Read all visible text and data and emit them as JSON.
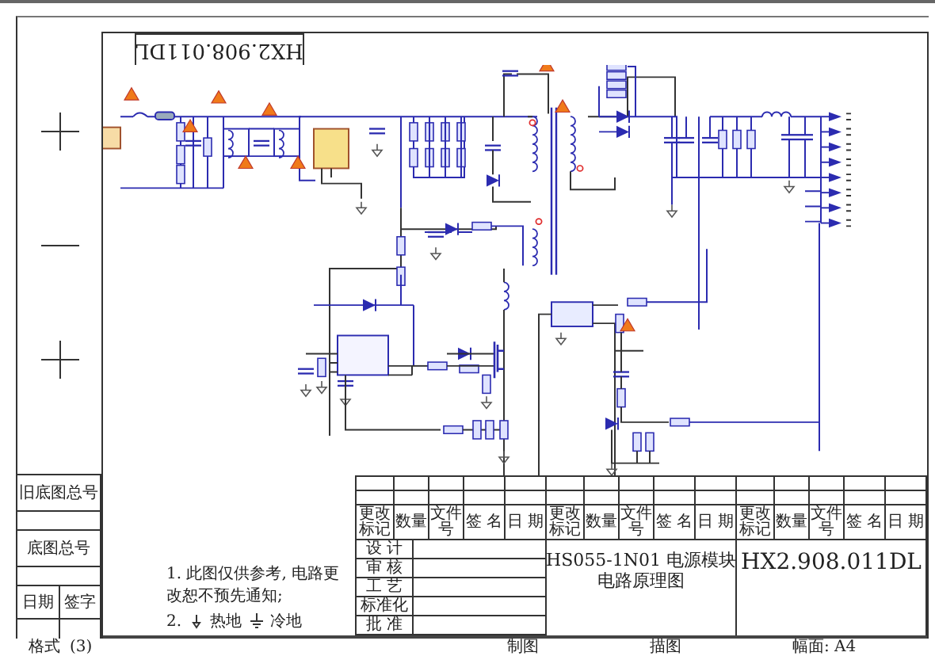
{
  "sheet_code_rotated": "HX2.908.011DL",
  "side_labels": [
    "旧底图总号",
    "底图总号"
  ],
  "side_signature": [
    "日期",
    "签字"
  ],
  "notes": [
    {
      "kind": "text",
      "text": "1. 此图仅供参考, 电路更改恕不预先通知;"
    },
    {
      "kind": "legend",
      "number": "2.",
      "items": [
        {
          "kind": "hot",
          "label": "热地"
        },
        {
          "kind": "cold",
          "label": "冷地"
        }
      ]
    }
  ],
  "revision_headers": [
    "更改标记",
    "数量",
    "文件号",
    "签 名",
    "日 期",
    "更改标记",
    "数量",
    "文件号",
    "签 名",
    "日 期",
    "更改标记",
    "数量",
    "文件号",
    "签 名",
    "日 期"
  ],
  "approval_rows": [
    "设 计",
    "审 核",
    "工 艺",
    "标准化",
    "批 准"
  ],
  "title": [
    "HS055-1N01 电源模块",
    "电路原理图"
  ],
  "drawing_number": "HX2.908.011DL",
  "footer": {
    "format": "格式",
    "format_number": "(3)",
    "fields": [
      "制图",
      "描图",
      "幅面: A4"
    ]
  }
}
